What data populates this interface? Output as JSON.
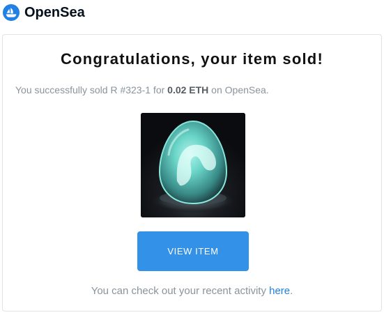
{
  "brand": {
    "name": "OpenSea",
    "logo_icon": "opensea-logo-icon",
    "logo_color": "#2081e2"
  },
  "email": {
    "title": "Congratulations, your item sold!",
    "message": {
      "prefix": "You successfully sold R #323-1 for ",
      "price": "0.02 ETH",
      "suffix": " on OpenSea."
    },
    "item_image": "glowing-egg-nft-image",
    "view_button_label": "VIEW ITEM",
    "view_button_color": "#3392e8",
    "footer": {
      "prefix": "You can check out your recent activity ",
      "link_text": "here",
      "suffix": "."
    }
  }
}
